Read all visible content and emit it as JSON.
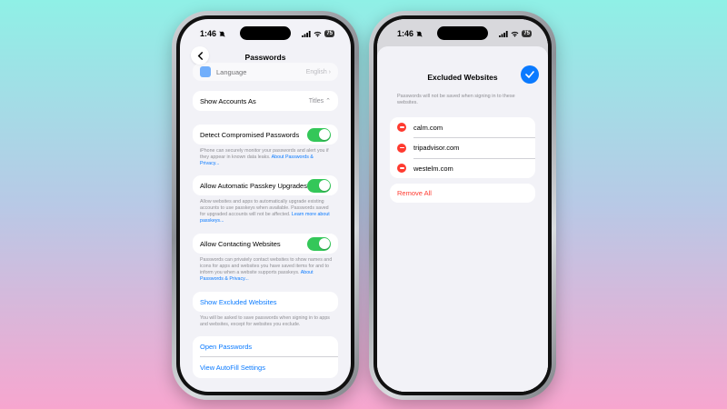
{
  "left_phone": {
    "status": {
      "time": "1:46",
      "battery": "75"
    },
    "nav": {
      "title": "Passwords"
    },
    "language": {
      "label": "Language",
      "value": "English"
    },
    "show_accounts": {
      "label": "Show Accounts As",
      "value": "Titles"
    },
    "detect": {
      "label": "Detect Compromised Passwords",
      "footnote": "iPhone can securely monitor your passwords and alert you if they appear in known data leaks.",
      "link": "About Passwords & Privacy..."
    },
    "passkey": {
      "label": "Allow Automatic Passkey Upgrades",
      "footnote": "Allow websites and apps to automatically upgrade existing accounts to use passkeys when available. Passwords saved for upgraded accounts will not be affected.",
      "link": "Learn more about passkeys..."
    },
    "contacting": {
      "label": "Allow Contacting Websites",
      "footnote": "Passwords can privately contact websites to show names and icons for apps and websites you have saved items for and to inform you when a website supports passkeys.",
      "link": "About Passwords & Privacy..."
    },
    "excluded": {
      "label": "Show Excluded Websites",
      "footnote": "You will be asked to save passwords when signing in to apps and websites, except for websites you exclude."
    },
    "actions": {
      "open_passwords": "Open Passwords",
      "view_autofill": "View AutoFill Settings"
    }
  },
  "right_phone": {
    "status": {
      "time": "1:46",
      "battery": "75"
    },
    "sheet": {
      "title": "Excluded Websites",
      "note": "Passwords will not be saved when signing in to these websites.",
      "sites": [
        "calm.com",
        "tripadvisor.com",
        "westelm.com"
      ],
      "remove_all": "Remove All"
    }
  },
  "colors": {
    "accent": "#0a7aff",
    "toggle_on": "#34c759",
    "destructive": "#ff3b30"
  }
}
